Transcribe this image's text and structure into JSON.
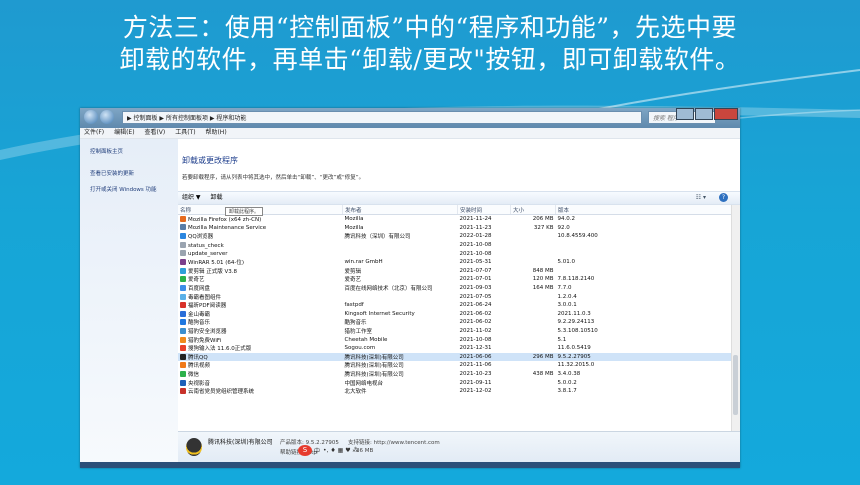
{
  "slide": {
    "title_line1": "方法三：使用“控制面板”中的“程序和功能”，先选中要",
    "title_line2": "卸载的软件，再单击“卸载/更改\"按钮，即可卸载软件。"
  },
  "window": {
    "address": "▶ 控制面板 ▶ 所有控制面板项 ▶ 程序和功能",
    "search_placeholder": "搜索 程序..."
  },
  "menu": [
    "文件(F)",
    "编辑(E)",
    "查看(V)",
    "工具(T)",
    "帮助(H)"
  ],
  "sidebar": {
    "items": [
      {
        "label": "控制面板主页"
      },
      {
        "label": "查看已安装的更新"
      },
      {
        "label": "打开或关闭 Windows 功能"
      }
    ]
  },
  "main": {
    "heading": "卸载或更改程序",
    "subtext": "若要卸载程序，请从列表中将其选中，然后单击“卸载”、“更改”或“修复”。",
    "toolbar": {
      "organize": "组织 ▼",
      "uninstall": "卸载"
    },
    "tooltip": "卸载此程序。"
  },
  "table": {
    "columns": [
      "名称",
      "发布者",
      "安装时间",
      "大小",
      "版本"
    ],
    "rows": [
      {
        "name": "Mozilla Firefox (x64 zh-CN)",
        "publisher": "Mozilla",
        "date": "2021-11-24",
        "size": "206 MB",
        "version": "94.0.2",
        "color": "#e66b1e"
      },
      {
        "name": "Mozilla Maintenance Service",
        "publisher": "Mozilla",
        "date": "2021-11-23",
        "size": "327 KB",
        "version": "92.0",
        "color": "#5a7ea8"
      },
      {
        "name": "QQ浏览器",
        "publisher": "腾讯科技（深圳）有限公司",
        "date": "2022-01-28",
        "size": "",
        "version": "10.8.4559.400",
        "color": "#2a86e0"
      },
      {
        "name": "status_check",
        "publisher": "",
        "date": "2021-10-08",
        "size": "",
        "version": "",
        "color": "#9aa4b0"
      },
      {
        "name": "update_server",
        "publisher": "",
        "date": "2021-10-08",
        "size": "",
        "version": "",
        "color": "#9aa4b0"
      },
      {
        "name": "WinRAR 5.01 (64-位)",
        "publisher": "win.rar GmbH",
        "date": "2021-05-31",
        "size": "",
        "version": "5.01.0",
        "color": "#7b3f8c"
      },
      {
        "name": "爱剪辑 正式版 V3.8",
        "publisher": "爱剪辑",
        "date": "2021-07-07",
        "size": "848 MB",
        "version": "",
        "color": "#2fa0d8"
      },
      {
        "name": "爱奇艺",
        "publisher": "爱奇艺",
        "date": "2021-07-01",
        "size": "120 MB",
        "version": "7.8.118.2140",
        "color": "#2cb24a"
      },
      {
        "name": "百度网盘",
        "publisher": "百度在线网络技术（北京）有限公司",
        "date": "2021-09-03",
        "size": "164 MB",
        "version": "7.7.0",
        "color": "#3d8ee8"
      },
      {
        "name": "毒霸看图组件",
        "publisher": "",
        "date": "2021-07-05",
        "size": "",
        "version": "1.2.0.4",
        "color": "#5ab0e8"
      },
      {
        "name": "福昕PDF阅读器",
        "publisher": "fastpdf",
        "date": "2021-06-24",
        "size": "",
        "version": "3.0.0.1",
        "color": "#d8322a"
      },
      {
        "name": "金山毒霸",
        "publisher": "Kingsoft Internet Security",
        "date": "2021-06-02",
        "size": "",
        "version": "2021.11.0.3",
        "color": "#2a6ed8"
      },
      {
        "name": "酷狗音乐",
        "publisher": "酷狗音乐",
        "date": "2021-06-02",
        "size": "",
        "version": "9.2.29.24113",
        "color": "#1f78e0"
      },
      {
        "name": "猎豹安全浏览器",
        "publisher": "猎豹工作室",
        "date": "2021-11-02",
        "size": "",
        "version": "5.3.108.10510",
        "color": "#3a8fd0"
      },
      {
        "name": "猎豹免费WiFi",
        "publisher": "Cheetah Mobile",
        "date": "2021-10-08",
        "size": "",
        "version": "5.1",
        "color": "#f08a1c"
      },
      {
        "name": "搜狗输入法 11.6.0正式版",
        "publisher": "Sogou.com",
        "date": "2021-12-31",
        "size": "",
        "version": "11.6.0.5419",
        "color": "#e8412a"
      },
      {
        "name": "腾讯QQ",
        "publisher": "腾讯科技(深圳)有限公司",
        "date": "2021-06-06",
        "size": "296 MB",
        "version": "9.5.2.27905",
        "color": "#222222",
        "selected": true
      },
      {
        "name": "腾讯视频",
        "publisher": "腾讯科技(深圳)有限公司",
        "date": "2021-11-06",
        "size": "",
        "version": "11.32.2015.0",
        "color": "#f07a1a"
      },
      {
        "name": "微信",
        "publisher": "腾讯科技(深圳)有限公司",
        "date": "2021-10-23",
        "size": "438 MB",
        "version": "3.4.0.38",
        "color": "#2cb04a"
      },
      {
        "name": "央视影音",
        "publisher": "中国网络电视台",
        "date": "2021-09-11",
        "size": "",
        "version": "5.0.0.2",
        "color": "#1e5fb8"
      },
      {
        "name": "云南省党员党组织管理系统",
        "publisher": "北大软件",
        "date": "2021-12-02",
        "size": "",
        "version": "3.8.1.7",
        "color": "#c8322a"
      }
    ]
  },
  "details": {
    "company": "腾讯科技(深圳)有限公司",
    "version": "产品版本: 9.5.2.27905",
    "support": "支持链接: http://www.tencent.com",
    "help": "帮助链接: http",
    "size": "36 MB",
    "ime_label": "中"
  }
}
